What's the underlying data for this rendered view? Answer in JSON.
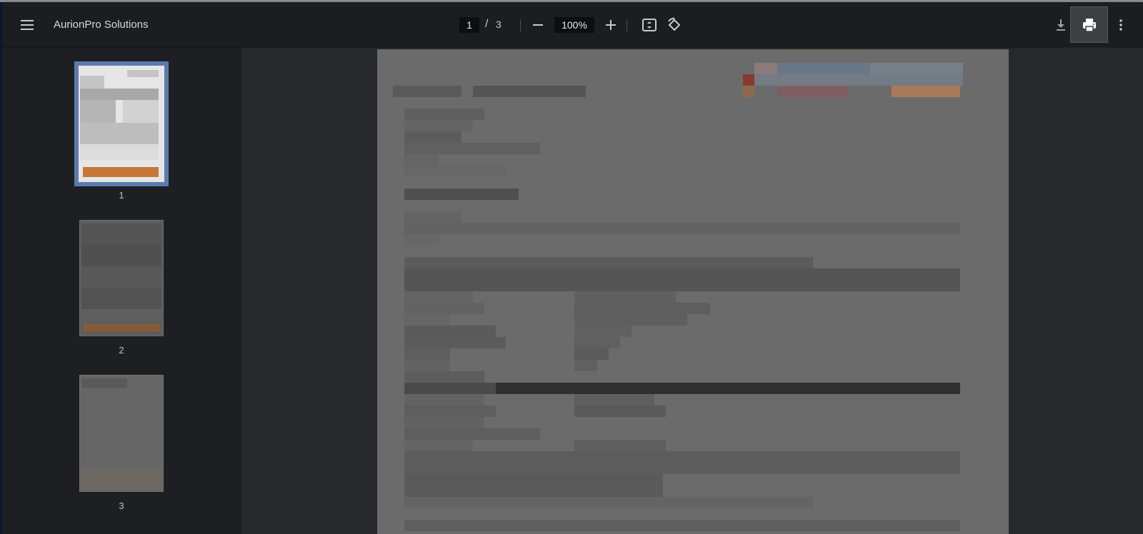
{
  "toolbar": {
    "document_title": "AurionPro Solutions",
    "current_page": "1",
    "page_separator": "/",
    "total_pages": "3",
    "zoom_level": "100%",
    "icons": {
      "menu": "menu-icon",
      "zoom_out": "minus-icon",
      "zoom_in": "plus-icon",
      "fit": "fit-to-page-icon",
      "rotate": "rotate-icon",
      "download": "download-icon",
      "print": "print-icon",
      "more": "more-vertical-icon"
    }
  },
  "sidebar": {
    "thumbnails": [
      {
        "page_label": "1",
        "selected": true
      },
      {
        "page_label": "2",
        "selected": false
      },
      {
        "page_label": "3",
        "selected": false
      }
    ]
  },
  "colors": {
    "toolbar_bg": "#1c1d20",
    "sidebar_bg": "#1e1f22",
    "viewer_bg": "#28292c",
    "selected_thumb_border": "#5b7bb0",
    "page_bg": "#6b6b6b",
    "accent_orange": "#c7763a"
  }
}
